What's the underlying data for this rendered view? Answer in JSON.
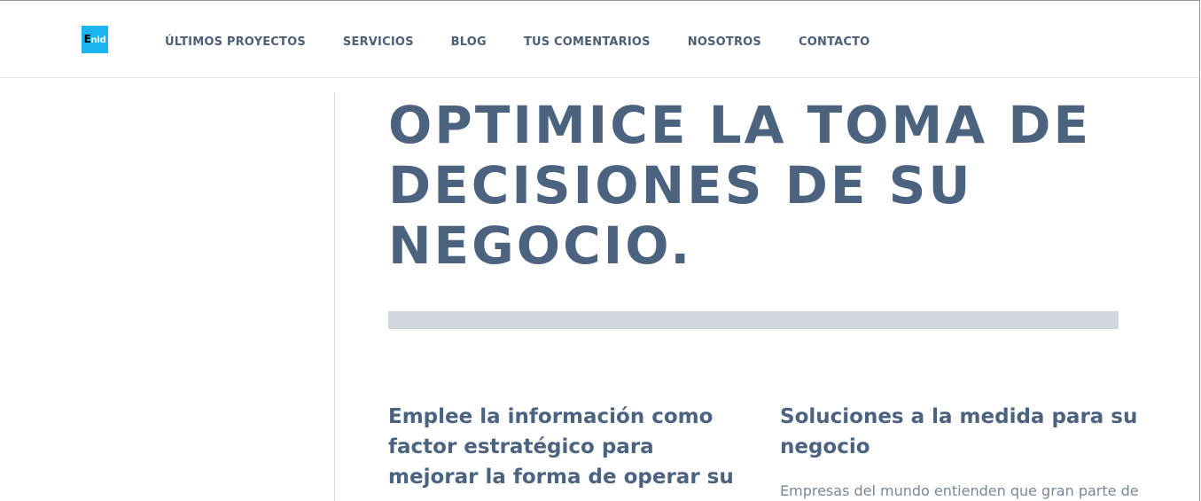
{
  "brand": {
    "logo_first": "E",
    "logo_rest": "nid",
    "logo_bg": "#1ab4f0"
  },
  "nav": {
    "items": [
      "ÚLTIMOS PROYECTOS",
      "SERVICIOS",
      "BLOG",
      "TUS COMENTARIOS",
      "NOSOTROS",
      "CONTACTO"
    ]
  },
  "hero": {
    "title": "OPTIMICE LA TOMA DE DECISIONES DE SU NEGOCIO."
  },
  "features": {
    "left_heading": "Emplee la información como factor estratégico para mejorar la forma de operar su",
    "right_heading": "Soluciones a la medida para su negocio",
    "right_text": "Empresas del mundo entienden que gran parte de"
  },
  "colors": {
    "heading": "#4c6380",
    "nav": "#4b5f78",
    "divider_bar": "#d1d6df",
    "body_text": "#7b8798"
  }
}
